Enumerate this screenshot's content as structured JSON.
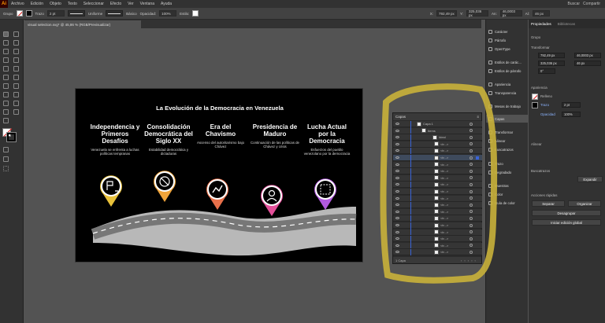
{
  "menubar": {
    "logo": "Ai",
    "items": [
      "Archivo",
      "Edición",
      "Objeto",
      "Texto",
      "Seleccionar",
      "Efecto",
      "Ver",
      "Ventana",
      "Ayuda"
    ],
    "right": [
      "Buscar",
      "Compartir"
    ]
  },
  "control_bar": {
    "selection": "Grupo",
    "stroke_label": "Trazo",
    "stroke_weight": "2 pt",
    "profile": "Uniforme",
    "brush": "Básico",
    "opacity_label": "Opacidad:",
    "opacity": "100%",
    "style_label": "Estilo:",
    "x": "792,49 px",
    "y": "325,036 px",
    "w": "46,0003 px",
    "h": "46 px"
  },
  "document_tab": "visual selection.svg* @ 45,86 % (RGB/Previsualizar)",
  "artboard": {
    "title": "La Evolución de la Democracia en Venezuela",
    "stages": [
      {
        "title": "Independencia y Primeros Desafíos",
        "desc": "Venezuela se enfrenta a luchas políticas tempranas",
        "color": "#e8c13a"
      },
      {
        "title": "Consolidación Democrática del Siglo XX",
        "desc": "Estabilidad democrática y dictaduras",
        "color": "#f0a43a"
      },
      {
        "title": "Era del Chavismo",
        "desc": "Ascenso del autoritarismo bajo Chávez",
        "color": "#e8704a"
      },
      {
        "title": "Presidencia de Maduro",
        "desc": "Continuación de las políticas de Chávez y crisis",
        "color": "#e4509a"
      },
      {
        "title": "Lucha Actual por la Democracia",
        "desc": "Esfuerzos del pueblo venezolano por la democracia",
        "color": "#b25ae0"
      }
    ]
  },
  "layers_panel": {
    "tab": "Capas",
    "layer": "Capa 1",
    "group1": "Items",
    "group2": "Ideal",
    "path_label": "<tr...>",
    "footer": "1 Capa"
  },
  "dock": {
    "items": [
      "Carácter",
      "Párrafo",
      "OpenType",
      "Estilos de carác...",
      "Estilos de párrafo",
      "Apariencia",
      "Transparencia",
      "Mesas de trabajo",
      "Capas",
      "Transformar",
      "Alinear",
      "Buscatrazos",
      "Trazo",
      "Degradado",
      "Muestras",
      "Color",
      "Guía de color"
    ]
  },
  "properties": {
    "tabs": [
      "Propiedades",
      "Bibliotecas"
    ],
    "group": "Grupo",
    "transform": "Transformar",
    "x": "792,49 px",
    "y": "325,036 px",
    "w": "46,0003 px",
    "h": "46 px",
    "angle": "0°",
    "appearance": "Apariencia",
    "fill": "Relleno",
    "stroke": "Trazo",
    "stroke_weight": "2 pt",
    "opacity": "Opacidad",
    "opacity_val": "100%",
    "align": "Alinear",
    "select_same": "Buscatrazos",
    "quick_actions": "Acciones rápidas",
    "btn_ungroup": "Desagrupar",
    "btn_edit_global": "Iniciar edición global",
    "btn_split": "Separar",
    "btn_arrange": "Organizar",
    "btn_offset": "Expandir"
  },
  "colors": {
    "highlight": "#c9b13a",
    "accent": "#3a64d8"
  }
}
